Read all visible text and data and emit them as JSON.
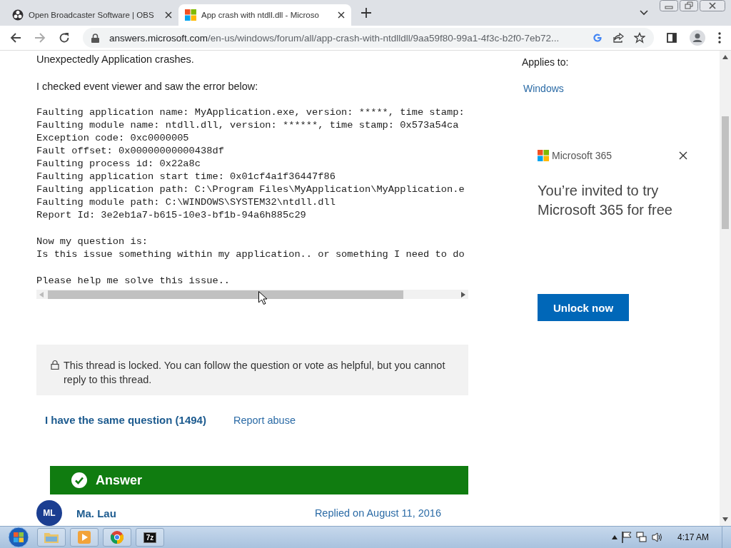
{
  "browser": {
    "tabs": [
      {
        "title": "Open Broadcaster Software | OBS",
        "kind": "obs",
        "selected": false
      },
      {
        "title": "App crash with ntdll.dll - Microso",
        "kind": "microsoft",
        "selected": true
      }
    ],
    "url_host": "answers.microsoft.com",
    "url_path": "/en-us/windows/forum/all/app-crash-with-ntdlldll/9aa59f80-99a1-4f3c-b2f0-7eb72..."
  },
  "post": {
    "intro": "Unexpectedly Application crashes.",
    "lead": "I checked event viewer and saw the error below:",
    "code_blocks": [
      [
        "Faulting application name: MyApplication.exe, version: *****, time stamp:",
        "Faulting module name: ntdll.dll, version: ******, time stamp: 0x573a54ca",
        "Exception code: 0xc0000005",
        "Fault offset: 0x00000000000438df",
        "Faulting process id: 0x22a8c",
        "Faulting application start time: 0x01cf4a1f36447f86",
        "Faulting application path: C:\\Program Files\\MyApplication\\MyApplication.e",
        "Faulting module path: C:\\WINDOWS\\SYSTEM32\\ntdll.dll",
        "Report Id: 3e2eb1a7-b615-10e3-bf1b-94a6h885c29"
      ],
      [
        "Now my question is:",
        "Is this issue something within my application.. or something I need to do"
      ],
      [
        "Please help me solve this issue.."
      ]
    ],
    "locked_notice": "This thread is locked. You can follow the question or vote as helpful, but you cannot reply to this thread.",
    "actions": [
      {
        "label": "I have the same question (1494)",
        "kind": "button"
      },
      {
        "label": "Report abuse",
        "kind": "link"
      }
    ]
  },
  "answer": {
    "header": "Answer",
    "initials": "ML",
    "author": "Ma. Lau",
    "replied": "Replied on August 11, 2016"
  },
  "sidebar": {
    "applies_label": "Applies to:",
    "applies": [
      "Windows"
    ],
    "ad": {
      "brand": "Microsoft 365",
      "headline": "You’re invited to try Microsoft 365 for free",
      "button": "Unlock now"
    }
  },
  "taskbar": {
    "apps": [
      {
        "kind": "explorer"
      },
      {
        "kind": "media"
      },
      {
        "kind": "chrome"
      },
      {
        "kind": "archiver",
        "label": "7z"
      }
    ],
    "clock": "4:17 AM"
  }
}
